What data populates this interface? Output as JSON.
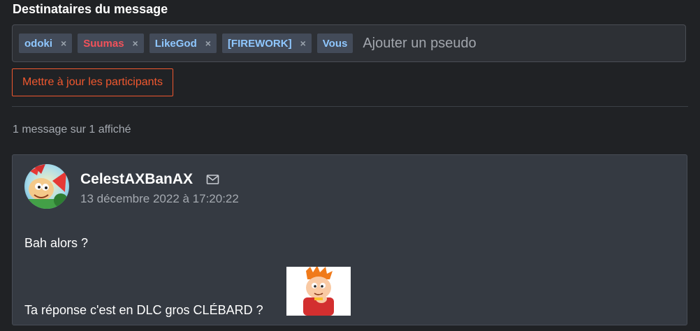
{
  "recipients": {
    "heading": "Destinataires du message",
    "chips": [
      {
        "name": "odoki",
        "color": "#8fc7ff",
        "removable": true
      },
      {
        "name": "Suumas",
        "color": "#f2525a",
        "removable": true
      },
      {
        "name": "LikeGod",
        "color": "#8fc7ff",
        "removable": true
      },
      {
        "name": "[FIREWORK]",
        "color": "#8fc7ff",
        "removable": true
      },
      {
        "name": "Vous",
        "color": "#8fc7ff",
        "removable": false
      }
    ],
    "remove_glyph": "×",
    "input_placeholder": "Ajouter un pseudo",
    "update_button": "Mettre à jour les participants"
  },
  "list": {
    "count_text": "1 message sur 1 affiché"
  },
  "message": {
    "author": "CelestAXBanAX",
    "date": "13 décembre 2022 à 17:20:22",
    "line1": "Bah alors ?",
    "line2": "Ta réponse c'est en DLC gros CLÉBARD ?",
    "icons": {
      "mail": "envelope-icon",
      "avatar": "avatar-image",
      "sticker": "sticker-image"
    }
  },
  "colors": {
    "accent": "#f0582f",
    "background": "#202225",
    "panel": "#353a42",
    "chip_bg": "#434b59"
  }
}
